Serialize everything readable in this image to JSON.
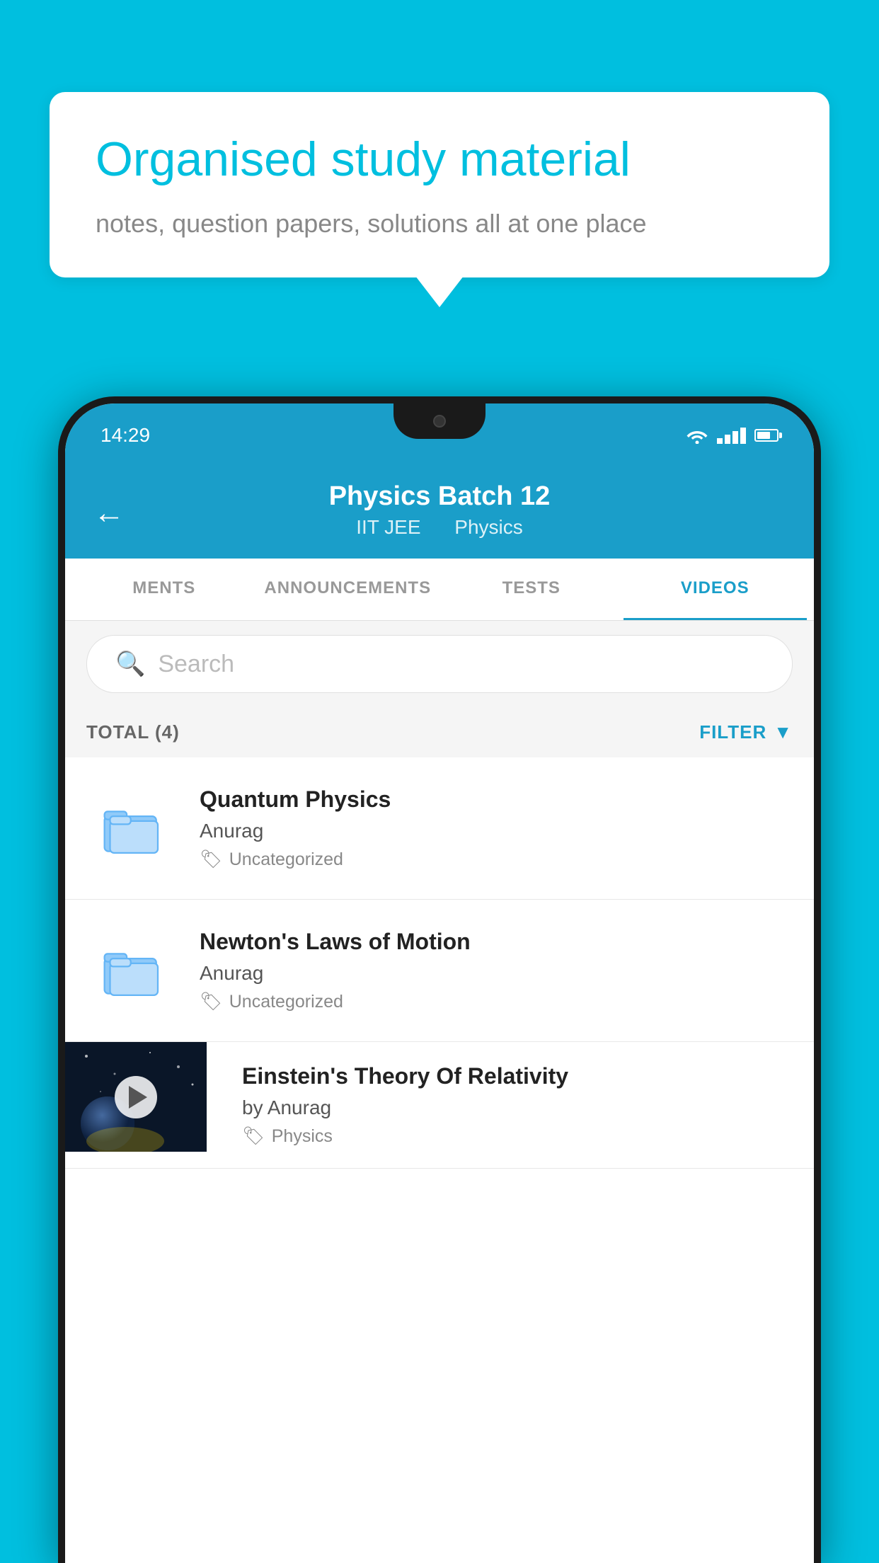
{
  "background_color": "#00BFDF",
  "bubble": {
    "title": "Organised study material",
    "subtitle": "notes, question papers, solutions all at one place"
  },
  "phone": {
    "status_bar": {
      "time": "14:29"
    },
    "header": {
      "title": "Physics Batch 12",
      "subtitle_part1": "IIT JEE",
      "subtitle_part2": "Physics",
      "back_label": "←"
    },
    "tabs": [
      {
        "label": "MENTS",
        "active": false
      },
      {
        "label": "ANNOUNCEMENTS",
        "active": false
      },
      {
        "label": "TESTS",
        "active": false
      },
      {
        "label": "VIDEOS",
        "active": true
      }
    ],
    "search": {
      "placeholder": "Search"
    },
    "filter_bar": {
      "total_label": "TOTAL (4)",
      "filter_label": "FILTER"
    },
    "videos": [
      {
        "id": 1,
        "title": "Quantum Physics",
        "author": "Anurag",
        "tag": "Uncategorized",
        "has_thumbnail": false
      },
      {
        "id": 2,
        "title": "Newton's Laws of Motion",
        "author": "Anurag",
        "tag": "Uncategorized",
        "has_thumbnail": false
      },
      {
        "id": 3,
        "title": "Einstein's Theory Of Relativity",
        "author": "by Anurag",
        "tag": "Physics",
        "has_thumbnail": true
      }
    ]
  }
}
